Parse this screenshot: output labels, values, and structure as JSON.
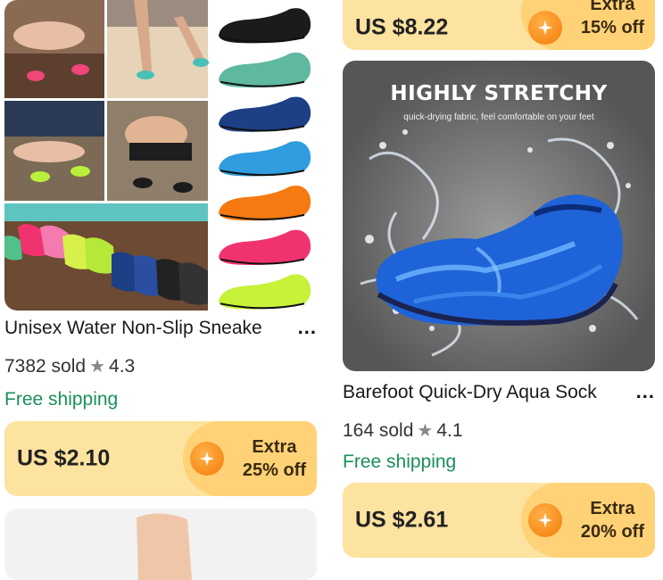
{
  "products": [
    {
      "title": "Unisex Water Non-Slip Sneake",
      "sold": "7382 sold",
      "rating": "4.3",
      "shipping": "Free shipping",
      "price": "US $2.10",
      "extra_label": "Extra",
      "discount": "25% off"
    },
    {
      "banner_title": "HIGHLY STRETCHY",
      "banner_subtitle": "quick-drying fabric, feel comfortable on your feet",
      "title": "Barefoot Quick-Dry Aqua Sock",
      "sold": "164 sold",
      "rating": "4.1",
      "shipping": "Free shipping",
      "price": "US $2.61",
      "extra_label": "Extra",
      "discount": "20% off"
    }
  ],
  "top_card": {
    "price": "US $8.22",
    "extra_label": "Extra",
    "discount": "15% off"
  },
  "more_symbol": "...",
  "star_symbol": "★",
  "sock_colors": [
    "#1b1b1b",
    "#5fb8a0",
    "#1c3f86",
    "#2f9de0",
    "#f57a12",
    "#f0336f",
    "#c6f23a"
  ],
  "colors": {
    "price_card_bg": "#fde3a0",
    "deal_bg": "#ffd277",
    "shipping_green": "#1a8f5a",
    "coupon_orange": "#f57a06"
  }
}
